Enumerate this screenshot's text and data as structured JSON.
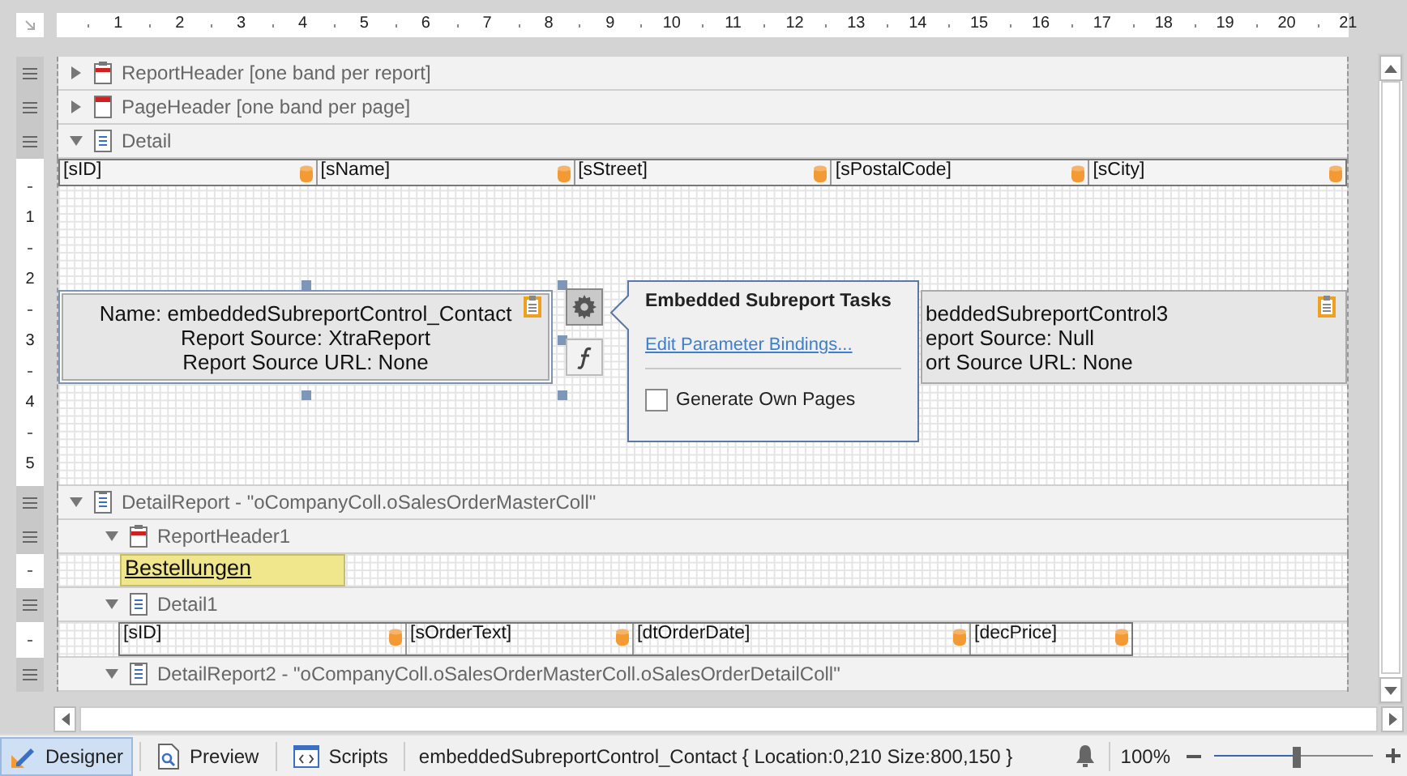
{
  "ruler": {
    "marks": [
      "1",
      "2",
      "3",
      "4",
      "5",
      "6",
      "7",
      "8",
      "9",
      "10",
      "11",
      "12",
      "13",
      "14",
      "15",
      "16",
      "17",
      "18",
      "19",
      "20",
      "21"
    ]
  },
  "bands": [
    {
      "kind": "report_header",
      "label": "ReportHeader [one band per report]",
      "expanded": false
    },
    {
      "kind": "page_header",
      "label": "PageHeader [one band per page]",
      "expanded": false
    },
    {
      "kind": "detail",
      "label": "Detail",
      "expanded": true,
      "ruler_marks": [
        "1",
        "2",
        "3",
        "4",
        "5"
      ],
      "fields": [
        "[sID]",
        "[sName]",
        "[sStreet]",
        "[sPostalCode]",
        "[sCity]"
      ],
      "subreports": [
        {
          "selected": true,
          "lines": [
            "Name: embeddedSubreportControl_Contact",
            "Report Source: XtraReport",
            "Report Source URL: None"
          ]
        },
        {
          "selected": false,
          "lines": [
            "beddedSubreportControl3",
            "eport Source: Null",
            "ort Source URL: None"
          ]
        }
      ],
      "task_panel": {
        "title": "Embedded Subreport Tasks",
        "link": "Edit Parameter Bindings...",
        "checkbox": {
          "label": "Generate Own Pages",
          "checked": false
        }
      }
    },
    {
      "kind": "detail_report",
      "label": "DetailReport - \"oCompanyColl.oSalesOrderMasterColl\"",
      "expanded": true,
      "children": [
        {
          "kind": "report_header",
          "label": "ReportHeader1",
          "expanded": true,
          "label_control": "Bestellungen"
        },
        {
          "kind": "detail",
          "label": "Detail1",
          "expanded": true,
          "fields": [
            "[sID]",
            "[sOrderText]",
            "[dtOrderDate]",
            "[decPrice]"
          ]
        },
        {
          "kind": "detail_report",
          "label": "DetailReport2 - \"oCompanyColl.oSalesOrderMasterColl.oSalesOrderDetailColl\"",
          "expanded": true
        }
      ]
    }
  ],
  "status_bar": {
    "tabs": [
      {
        "kind": "designer",
        "label": "Designer",
        "selected": true
      },
      {
        "kind": "preview",
        "label": "Preview",
        "selected": false
      },
      {
        "kind": "scripts",
        "label": "Scripts",
        "selected": false
      }
    ],
    "text": "embeddedSubreportControl_Contact { Location:0,210 Size:800,150 }",
    "zoom": {
      "reading": "100%",
      "level": 0.52
    }
  }
}
